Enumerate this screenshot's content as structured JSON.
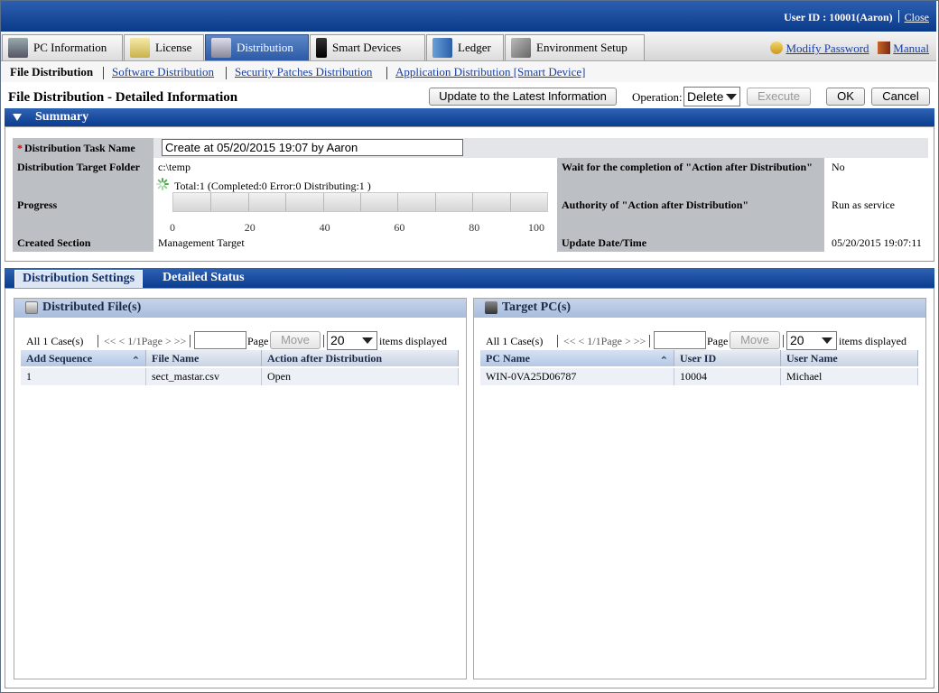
{
  "topbar": {
    "user_label": "User ID : 10001(Aaron)",
    "close": "Close",
    "color": "#0a3a8a"
  },
  "nav": {
    "tabs": [
      {
        "label": "PC Information",
        "icon": "pc-icon"
      },
      {
        "label": "License",
        "icon": "license-icon"
      },
      {
        "label": "Distribution",
        "icon": "distribution-icon",
        "active": true
      },
      {
        "label": "Smart Devices",
        "icon": "smartphone-icon"
      },
      {
        "label": "Ledger",
        "icon": "ledger-icon"
      },
      {
        "label": "Environment Setup",
        "icon": "tools-icon"
      }
    ],
    "modify_password": "Modify Password",
    "manual": "Manual"
  },
  "subnav": {
    "current": "File Distribution",
    "links": [
      "Software Distribution",
      "Security Patches Distribution",
      "Application Distribution [Smart Device]"
    ]
  },
  "header": {
    "title": "File Distribution - Detailed Information",
    "update_button": "Update to the Latest Information",
    "operation_label": "Operation:",
    "operation_value": "Delete",
    "execute_button": "Execute",
    "ok_button": "OK",
    "cancel_button": "Cancel"
  },
  "summary": {
    "section_title": "Summary",
    "task_name_label": "Distribution Task Name",
    "task_name_required": "*",
    "task_name_value": "Create at 05/20/2015 19:07 by Aaron",
    "target_folder_label": "Distribution Target Folder",
    "target_folder_value": "c:\\temp",
    "wait_label": "Wait for the completion of \"Action after Distribution\"",
    "wait_value": "No",
    "progress_label": "Progress",
    "progress_text": "Total:1  (Completed:0  Error:0  Distributing:1 )",
    "progress_fraction": 0,
    "progress_ticks": [
      "0",
      "20",
      "40",
      "60",
      "80",
      "100"
    ],
    "authority_label": "Authority of \"Action after Distribution\"",
    "authority_value": "Run as service",
    "created_section_label": "Created Section",
    "created_section_value": "Management Target",
    "update_datetime_label": "Update Date/Time",
    "update_datetime_value": "05/20/2015 19:07:11"
  },
  "lower_tabs": [
    "Distribution Settings",
    "Detailed Status"
  ],
  "files_panel": {
    "title": "Distributed File(s)",
    "pager": {
      "cases": "All 1 Case(s)",
      "nav": "<< < 1/1Page > >>",
      "page_label": "Page",
      "move": "Move",
      "per_page": "20",
      "items_displayed": "items displayed"
    },
    "columns": [
      "Add Sequence",
      "File Name",
      "Action after Distribution"
    ],
    "rows": [
      [
        "1",
        "sect_mastar.csv",
        "Open"
      ]
    ]
  },
  "targets_panel": {
    "title": "Target PC(s)",
    "pager": {
      "cases": "All 1 Case(s)",
      "nav": "<< < 1/1Page > >>",
      "page_label": "Page",
      "move": "Move",
      "per_page": "20",
      "items_displayed": "items displayed"
    },
    "columns": [
      "PC Name",
      "User ID",
      "User Name"
    ],
    "rows": [
      [
        "WIN-0VA25D06787",
        "10004",
        "Michael"
      ]
    ]
  }
}
